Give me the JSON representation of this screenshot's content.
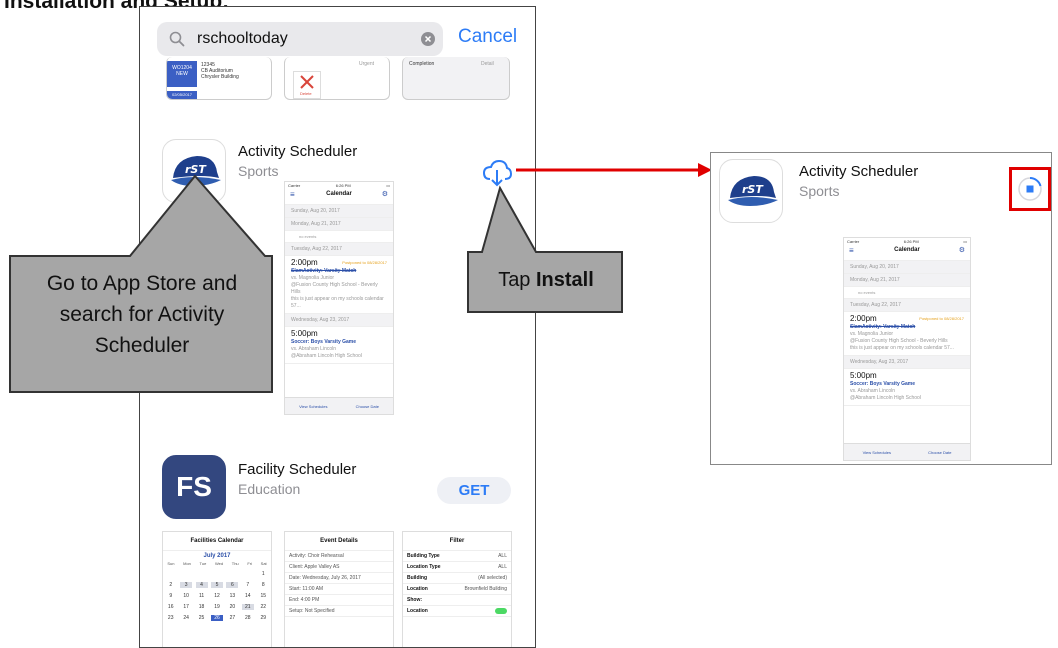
{
  "heading": "Installation and Setup:",
  "search": {
    "query": "rschooltoday",
    "cancel_label": "Cancel"
  },
  "top_strip": {
    "ticket_id": "WO1204",
    "ticket_num": "12345",
    "badge": "NEW",
    "location": "CB Auditorium",
    "building": "Chrysler Building",
    "date": "02/05/2017",
    "col2": "Urgent",
    "col3": "Completion",
    "col3b": "Detail",
    "delete": "Delete"
  },
  "activity_app": {
    "name": "Activity Scheduler",
    "category": "Sports",
    "logo_text": "rST"
  },
  "activity_screenshot": {
    "carrier": "Carrier",
    "clock": "6:26 PM",
    "title": "Calendar",
    "day1": "Sunday, Aug 20, 2017",
    "day2": "Monday, Aug 21, 2017",
    "no_events": "no events",
    "day3": "Tuesday, Aug 22, 2017",
    "time1": "2:00pm",
    "postponed": "Postponed to 08/28/2017",
    "event1": "SlamActivity: Varsity Match",
    "opp1": "vs. Magnolia Junior",
    "loc1": "@Fusion County High School - Beverly Hills",
    "note1": "this is just appear on my schools calendar 57...",
    "day4": "Wednesday, Aug 23, 2017",
    "time2": "5:00pm",
    "event2": "Soccer: Boys Varsity Game",
    "opp2": "vs. Abraham Lincoln",
    "loc2": "@Abraham Lincoln High School",
    "tab1": "View Schedules",
    "tab2": "Choose Date"
  },
  "facility_app": {
    "name": "Facility Scheduler",
    "category": "Education",
    "logo_text": "FS",
    "get_label": "GET"
  },
  "facility_shots": {
    "s1": {
      "title": "Facilities Calendar",
      "month": "July 2017",
      "days": [
        "Sun",
        "Mon",
        "Tue",
        "Wed",
        "Thu",
        "Fri",
        "Sat"
      ],
      "weeks": [
        [
          "",
          "",
          "",
          "",
          "",
          "",
          "1"
        ],
        [
          "2",
          "3",
          "4",
          "5",
          "6",
          "7",
          "8"
        ],
        [
          "9",
          "10",
          "11",
          "12",
          "13",
          "14",
          "15"
        ],
        [
          "16",
          "17",
          "18",
          "19",
          "20",
          "21",
          "22"
        ],
        [
          "23",
          "24",
          "25",
          "26",
          "27",
          "28",
          "29"
        ]
      ]
    },
    "s2": {
      "title": "Event Details",
      "rows": [
        "Activity: Choir Rehearsal",
        "Client: Apple Valley AS",
        "Date: Wednesday, July 26, 2017",
        "Start: 11:00 AM",
        "End: 4:00 PM",
        "Setup: Not Specified"
      ]
    },
    "s3": {
      "title": "Filter",
      "rows": [
        [
          "Building Type",
          "ALL"
        ],
        [
          "Location Type",
          "ALL"
        ],
        [
          "Building",
          "(All selected)"
        ],
        [
          "Location",
          "Brownfield Building"
        ],
        [
          "Show:",
          ""
        ],
        [
          "Location",
          ""
        ]
      ]
    }
  },
  "callouts": {
    "left": "Go to App Store and search for Activity Scheduler",
    "right_prefix": "Tap ",
    "right_bold": "Install"
  },
  "colors": {
    "ios_blue": "#2d7cf6",
    "callout_gray": "#a6a6a6",
    "arrow_red": "#e00000",
    "toggle_green": "#4cd964"
  },
  "icons": [
    "search-icon",
    "clear-icon",
    "cloud-download-icon",
    "download-progress-stop-icon",
    "menu-icon",
    "gear-icon"
  ]
}
